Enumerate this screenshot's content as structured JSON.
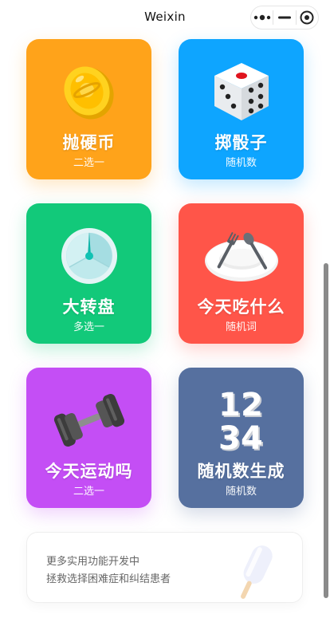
{
  "topbar": {
    "title": "Weixin"
  },
  "capsule": {
    "more_icon": "more-dots-icon",
    "minimize_icon": "minimize-icon",
    "close_icon": "target-close-icon"
  },
  "cards": [
    {
      "title": "抛硬币",
      "subtitle": "二选一",
      "icon": "coin-icon",
      "color": "#ffa31a"
    },
    {
      "title": "掷骰子",
      "subtitle": "随机数",
      "icon": "dice-icon",
      "color": "#0ea5ff"
    },
    {
      "title": "大转盘",
      "subtitle": "多选一",
      "icon": "spinner-wheel-icon",
      "color": "#12c97a"
    },
    {
      "title": "今天吃什么",
      "subtitle": "随机词",
      "icon": "plate-cutlery-icon",
      "color": "#ff5549"
    },
    {
      "title": "今天运动吗",
      "subtitle": "二选一",
      "icon": "dumbbell-icon",
      "color": "#c44ef5"
    },
    {
      "title": "随机数生成",
      "subtitle": "随机数",
      "icon": "numbers-1234-icon",
      "color": "#56709f"
    }
  ],
  "tip": {
    "line1": "更多实用功能开发中",
    "line2": "拯救选择困难症和纠结患者",
    "icon": "popsicle-icon"
  }
}
